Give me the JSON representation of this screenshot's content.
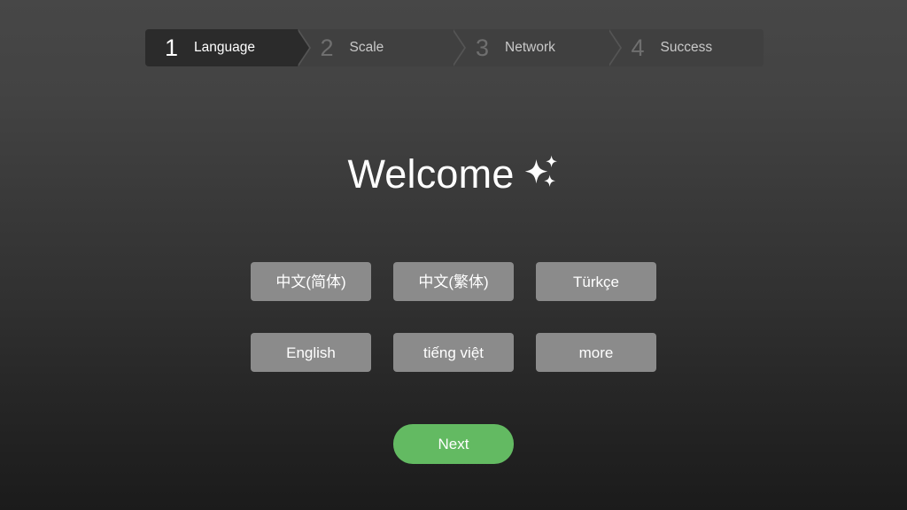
{
  "stepper": {
    "steps": [
      {
        "number": "1",
        "label": "Language",
        "active": true
      },
      {
        "number": "2",
        "label": "Scale",
        "active": false
      },
      {
        "number": "3",
        "label": "Network",
        "active": false
      },
      {
        "number": "4",
        "label": "Success",
        "active": false
      }
    ]
  },
  "main": {
    "title": "Welcome",
    "title_icon": "sparkles-icon"
  },
  "languages": [
    {
      "label": "中文(简体)"
    },
    {
      "label": "中文(繁体)"
    },
    {
      "label": "Türkçe"
    },
    {
      "label": "English"
    },
    {
      "label": "tiếng việt"
    },
    {
      "label": "more"
    }
  ],
  "actions": {
    "next_label": "Next"
  },
  "colors": {
    "accent_green": "#63ba62",
    "button_gray": "#8b8b8b",
    "step_active_bg": "#2b2b2b",
    "step_inactive_bg": "#404040",
    "text_primary": "#ffffff",
    "step_number_inactive": "#6f6f6f"
  }
}
